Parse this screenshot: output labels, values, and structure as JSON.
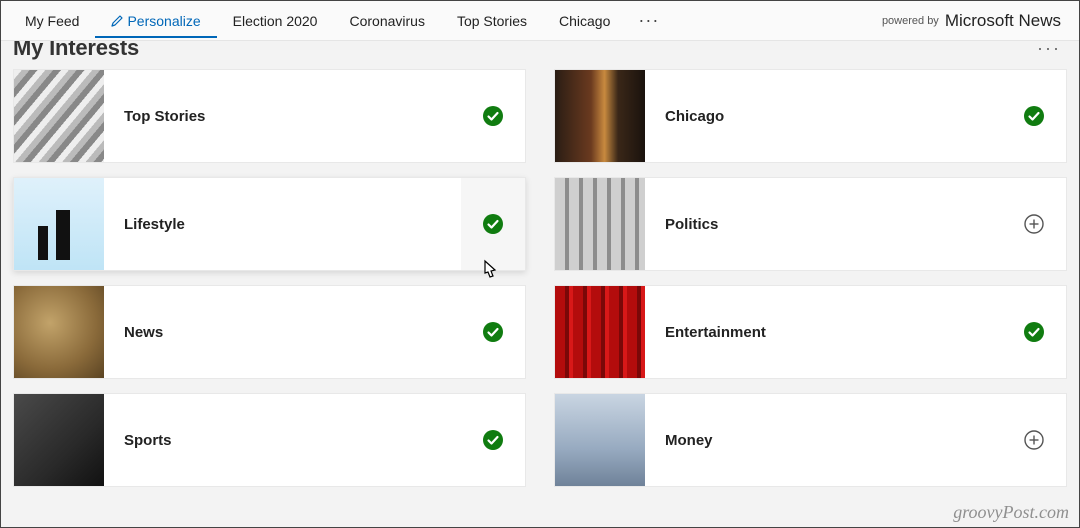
{
  "nav": {
    "items": [
      {
        "label": "My Feed"
      },
      {
        "label": "Personalize",
        "active": true,
        "icon": "pencil"
      },
      {
        "label": "Election 2020"
      },
      {
        "label": "Coronavirus"
      },
      {
        "label": "Top Stories"
      },
      {
        "label": "Chicago"
      }
    ],
    "more": "···",
    "powered_label": "powered by",
    "brand": "Microsoft News"
  },
  "page": {
    "heading": "My Interests",
    "more": "···"
  },
  "cards": [
    {
      "name": "Top Stories",
      "state": "checked",
      "thumb": "th-top"
    },
    {
      "name": "Chicago",
      "state": "checked",
      "thumb": "th-chicago"
    },
    {
      "name": "Lifestyle",
      "state": "checked",
      "thumb": "th-life",
      "hover": true
    },
    {
      "name": "Politics",
      "state": "add",
      "thumb": "th-pol"
    },
    {
      "name": "News",
      "state": "checked",
      "thumb": "th-news"
    },
    {
      "name": "Entertainment",
      "state": "checked",
      "thumb": "th-ent"
    },
    {
      "name": "Sports",
      "state": "checked",
      "thumb": "th-sports"
    },
    {
      "name": "Money",
      "state": "add",
      "thumb": "th-money"
    }
  ],
  "watermark": "groovyPost.com",
  "colors": {
    "accent": "#0067b8",
    "check": "#107c10"
  }
}
